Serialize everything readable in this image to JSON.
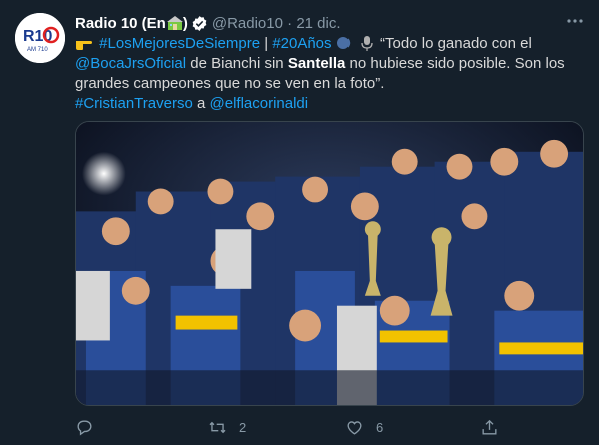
{
  "tweet": {
    "display_name": "Radio 10 (En ",
    "display_name_close": ")",
    "handle": "@Radio10",
    "separator": " · ",
    "date": "21 dic.",
    "avatar_label": "R10",
    "avatar_sub": "AM 710",
    "text": {
      "hashtag1": "#LosMejoresDeSiempre",
      "pipe": " | ",
      "hashtag2": "#20Años",
      "quote_start": " “Todo lo ganado con el",
      "mention1": "@BocaJrsOficial",
      "mid1": " de Bianchi sin ",
      "bold_name": "Santella",
      "mid2": " no hubiese sido posible. Son los grandes campeones que no se ven en la foto”.",
      "hashtag3": "#CristianTraverso",
      "connector": " a ",
      "mention2": "@elflacorinaldi"
    },
    "actions": {
      "reply_count": "",
      "retweet_count": "2",
      "like_count": "6",
      "share_count": ""
    }
  },
  "colors": {
    "background": "#15202b",
    "link": "#1da1f2",
    "muted": "#8899a6",
    "verified": "#1da1f2"
  },
  "icons": [
    "house-emoji-icon",
    "verified-badge-icon",
    "more-options-icon",
    "pointing-hand-icon",
    "speaking-head-icon",
    "microphone-icon",
    "reply-icon",
    "retweet-icon",
    "like-icon",
    "share-icon"
  ]
}
